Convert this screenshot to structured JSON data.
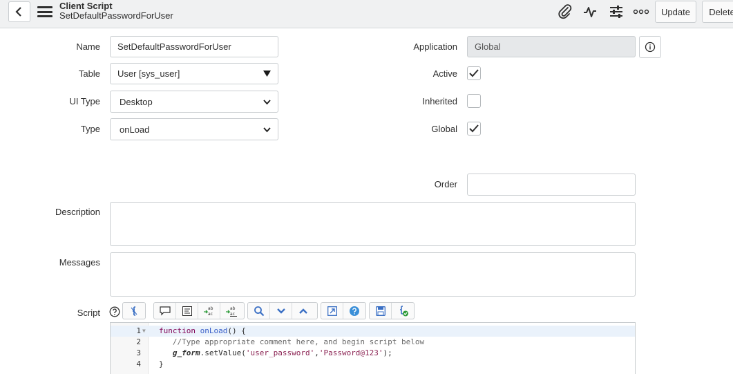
{
  "header": {
    "record_type": "Client Script",
    "record_name": "SetDefaultPasswordForUser",
    "update_label": "Update",
    "delete_label": "Delete",
    "icons": [
      "back-icon",
      "menu-icon",
      "paperclip-icon",
      "activity-icon",
      "sliders-icon",
      "more-icon"
    ]
  },
  "form": {
    "name": {
      "label": "Name",
      "value": "SetDefaultPasswordForUser"
    },
    "table": {
      "label": "Table",
      "value": "User [sys_user]"
    },
    "ui_type": {
      "label": "UI Type",
      "value": "Desktop"
    },
    "type": {
      "label": "Type",
      "value": "onLoad"
    },
    "application": {
      "label": "Application",
      "value": "Global"
    },
    "active": {
      "label": "Active",
      "checked": true
    },
    "inherited": {
      "label": "Inherited",
      "checked": false
    },
    "global": {
      "label": "Global",
      "checked": true
    },
    "order": {
      "label": "Order",
      "value": ""
    },
    "description": {
      "label": "Description",
      "value": ""
    },
    "messages": {
      "label": "Messages",
      "value": ""
    },
    "script": {
      "label": "Script",
      "lines": [
        {
          "num": "1",
          "fold": true,
          "text": "function onLoad() {"
        },
        {
          "num": "2",
          "fold": false,
          "text": "   //Type appropriate comment here, and begin script below"
        },
        {
          "num": "3",
          "fold": false,
          "text": "   g_form.setValue('user_password','Password@123');"
        },
        {
          "num": "4",
          "fold": false,
          "text": "}"
        }
      ]
    }
  },
  "colors": {
    "accent": "#293e40",
    "check": "#2e2e2e",
    "header_bg": "#f0f1f2"
  }
}
